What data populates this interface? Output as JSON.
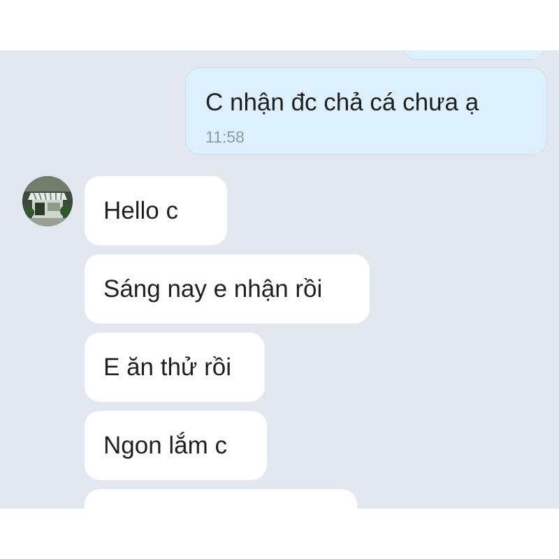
{
  "chat": {
    "outgoing": [
      {
        "text": "C nhận đc chả cá chưa ạ",
        "time": "11:58"
      }
    ],
    "incoming": [
      {
        "text": "Hello c"
      },
      {
        "text": "Sáng nay e nhận rồi"
      },
      {
        "text": "E ăn thử rồi"
      },
      {
        "text": "Ngon lắm c"
      }
    ]
  },
  "colors": {
    "chat_background": "#e3e7ef",
    "outgoing_bubble": "#dcf0fd",
    "incoming_bubble": "#ffffff",
    "timestamp": "#8c9aa8"
  },
  "icons": {
    "avatar": "shop-storefront-avatar"
  }
}
